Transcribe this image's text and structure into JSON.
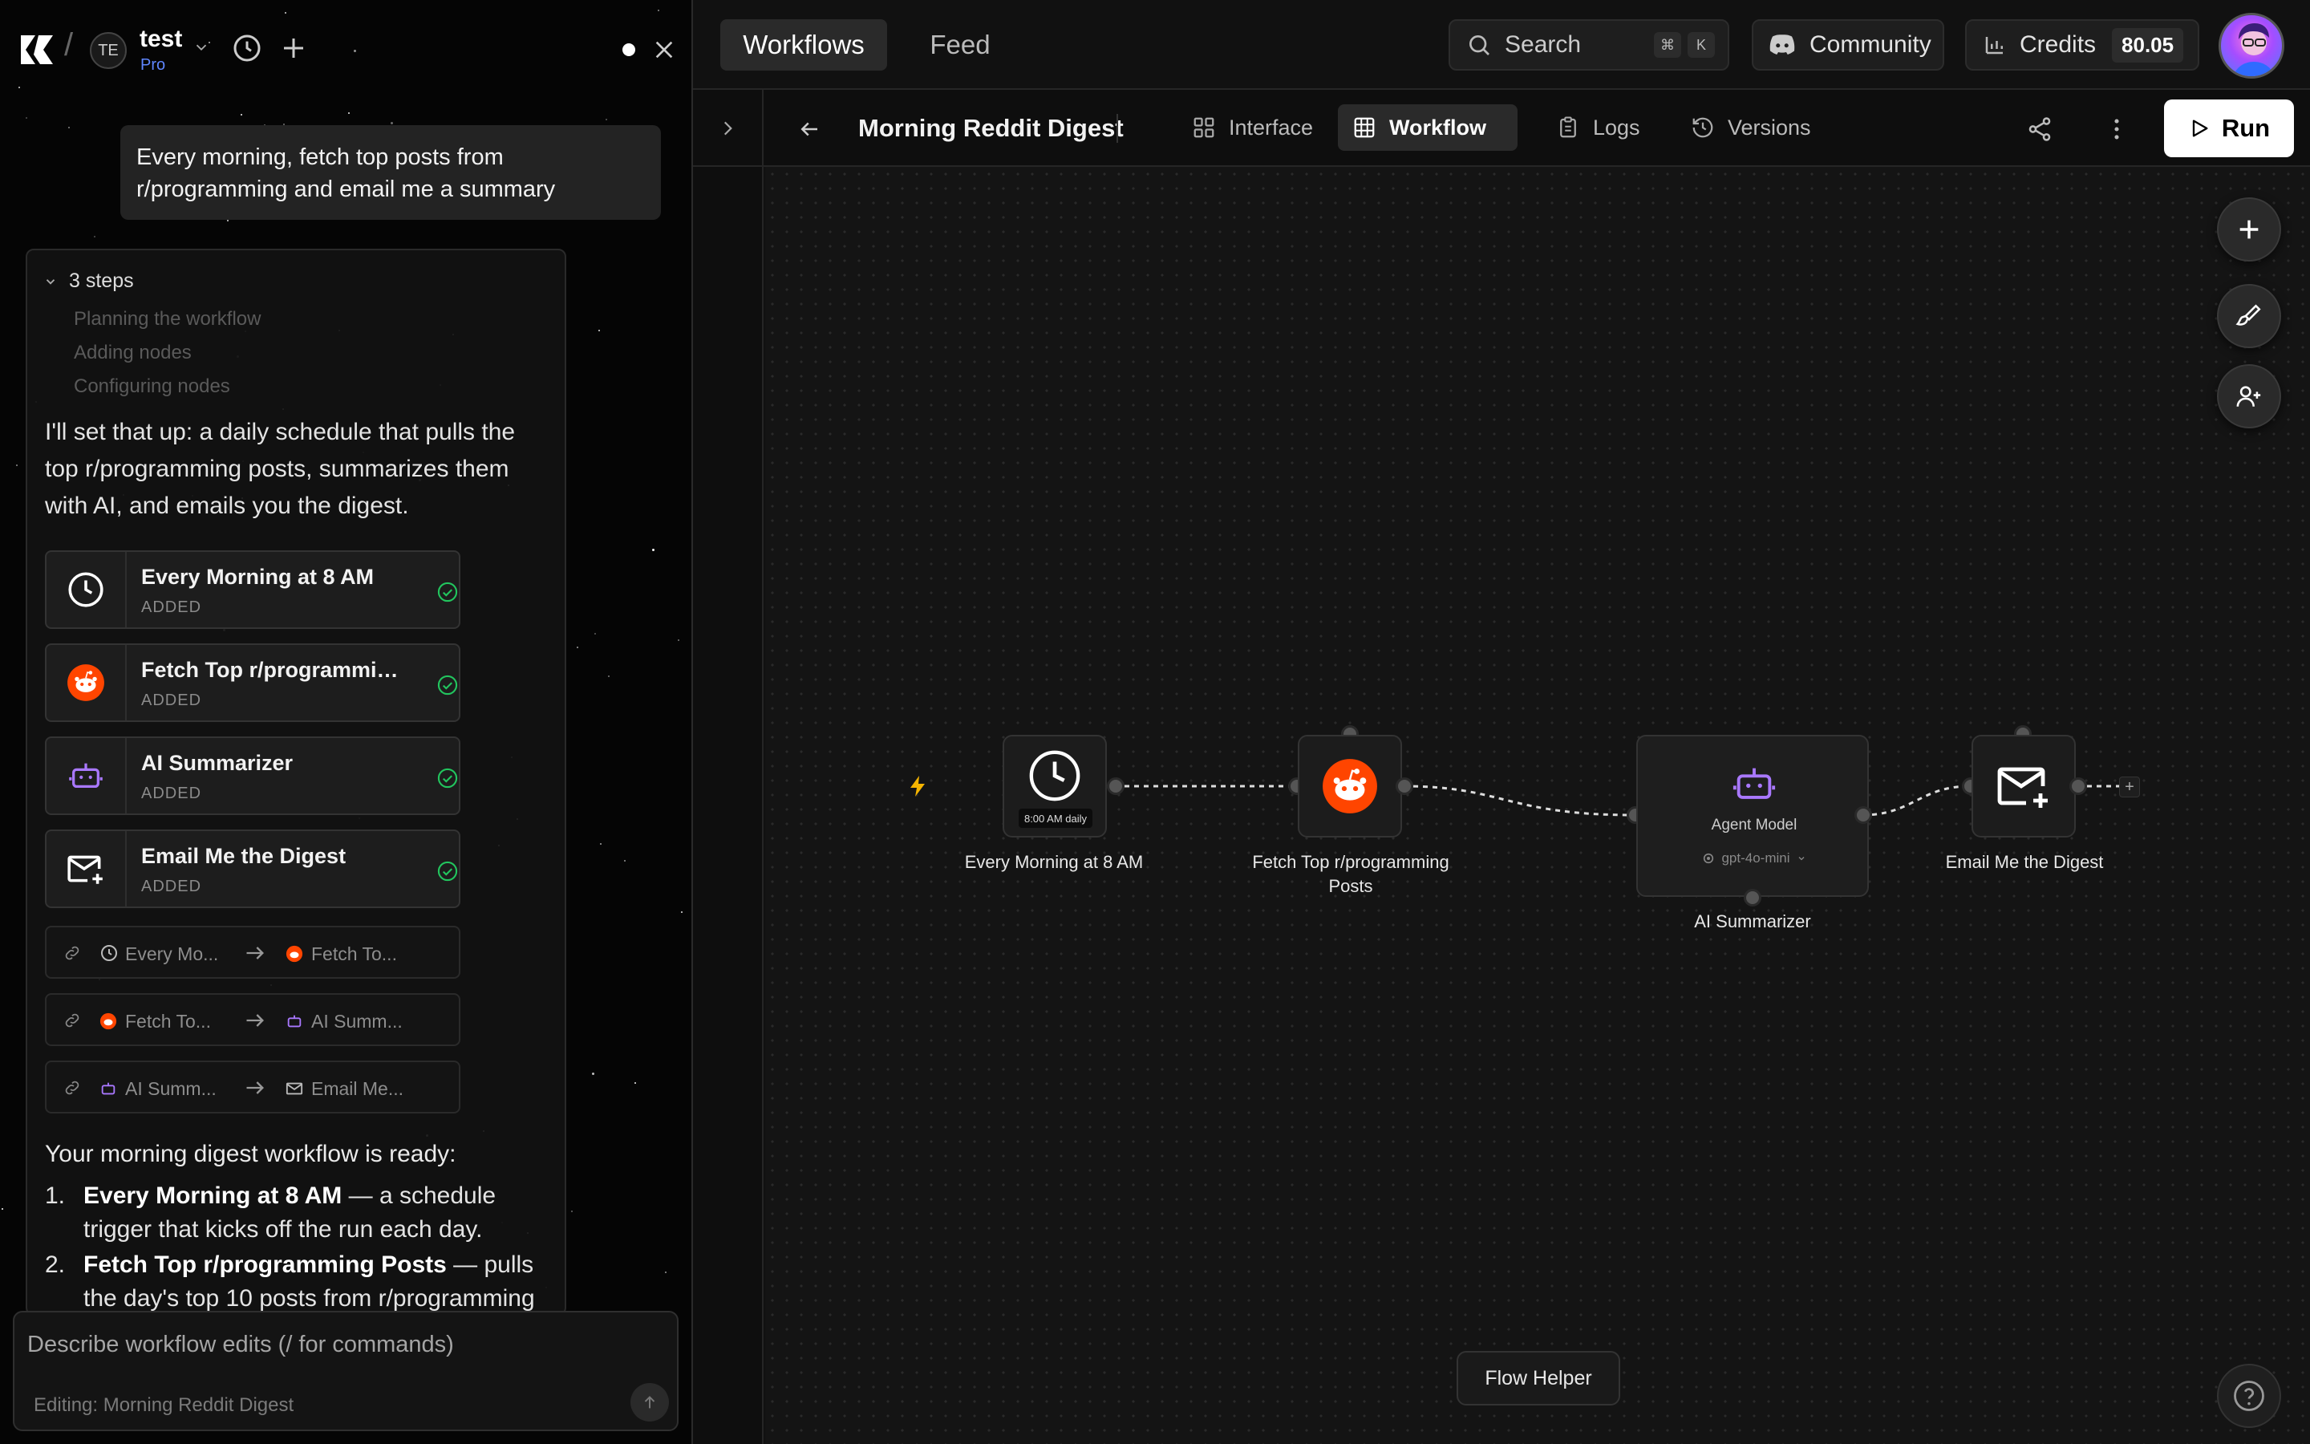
{
  "workspace": {
    "initials": "TE",
    "name": "test",
    "plan": "Pro"
  },
  "chat": {
    "user_message": "Every morning, fetch top posts from r/programming and email me a summary",
    "steps_header": "3 steps",
    "steps": [
      "Planning the workflow",
      "Adding nodes",
      "Configuring nodes"
    ],
    "intro": "I'll set that up: a daily schedule that pulls the top r/programming posts, summarizes them with AI, and emails you the digest.",
    "added_nodes": [
      {
        "name": "Every Morning at 8 AM",
        "status": "ADDED",
        "icon": "clock-icon"
      },
      {
        "name": "Fetch Top r/programmin...",
        "status": "ADDED",
        "icon": "reddit-icon"
      },
      {
        "name": "AI Summarizer",
        "status": "ADDED",
        "icon": "robot-icon"
      },
      {
        "name": "Email Me the Digest",
        "status": "ADDED",
        "icon": "mail-plus-icon"
      }
    ],
    "connections": [
      {
        "from": "Every Mo...",
        "to": "Fetch To..."
      },
      {
        "from": "Fetch To...",
        "to": "AI Summ..."
      },
      {
        "from": "AI Summ...",
        "to": "Email Me..."
      }
    ],
    "ready": "Your morning digest workflow is ready:",
    "summary": [
      {
        "num": "1.",
        "bold": "Every Morning at 8 AM",
        "text": " — a schedule trigger that kicks off the run each day."
      },
      {
        "num": "2.",
        "bold": "Fetch Top r/programming Posts",
        "text": " — pulls the day's top 10 posts from r/programming"
      }
    ],
    "input_placeholder": "Describe workflow edits (/ for commands)",
    "editing": "Editing: Morning Reddit Digest"
  },
  "topbar": {
    "tabs": [
      "Workflows",
      "Feed"
    ],
    "search_label": "Search",
    "search_keys": [
      "⌘",
      "K"
    ],
    "community": "Community",
    "credits_label": "Credits",
    "credits_value": "80.05"
  },
  "subbar": {
    "title": "Morning Reddit Digest",
    "tabs": [
      "Interface",
      "Workflow",
      "Logs",
      "Versions"
    ],
    "active_tab": "Workflow",
    "run": "Run"
  },
  "canvas": {
    "nodes": {
      "trigger": {
        "label": "Every Morning at 8 AM",
        "badge": "8:00 AM daily"
      },
      "reddit": {
        "label": "Fetch Top r/programming Posts"
      },
      "agent": {
        "label": "AI Summarizer",
        "title": "Agent Model",
        "model": "gpt-4o-mini"
      },
      "email": {
        "label": "Email Me the Digest"
      }
    },
    "flow_helper": "Flow Helper"
  },
  "colors": {
    "accent": "#ff4500",
    "check": "#22c55e",
    "robot": "#a978ff",
    "plan": "#5f86ff"
  }
}
